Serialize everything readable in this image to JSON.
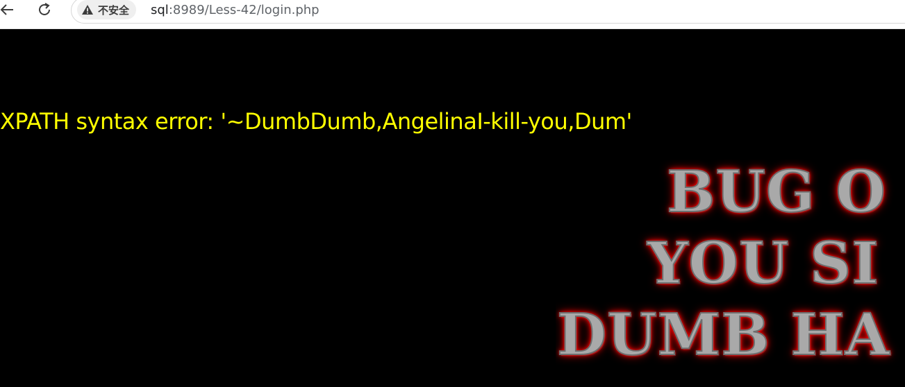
{
  "toolbar": {
    "back_icon": "arrow-left-icon",
    "reload_icon": "reload-icon",
    "security_icon": "warning-triangle-icon",
    "security_label": "不安全",
    "url_host": "sql",
    "url_rest": ":8989/Less-42/login.php"
  },
  "page": {
    "error_message": "XPATH syntax error: '~DumbDumb,AngelinaI-kill-you,Dum'",
    "banner_lines": [
      "BUG O",
      "YOU SI",
      "DUMB HA"
    ]
  },
  "colors": {
    "background": "#000000",
    "error_text": "#ffff00",
    "banner_glow": "#ff0000"
  }
}
